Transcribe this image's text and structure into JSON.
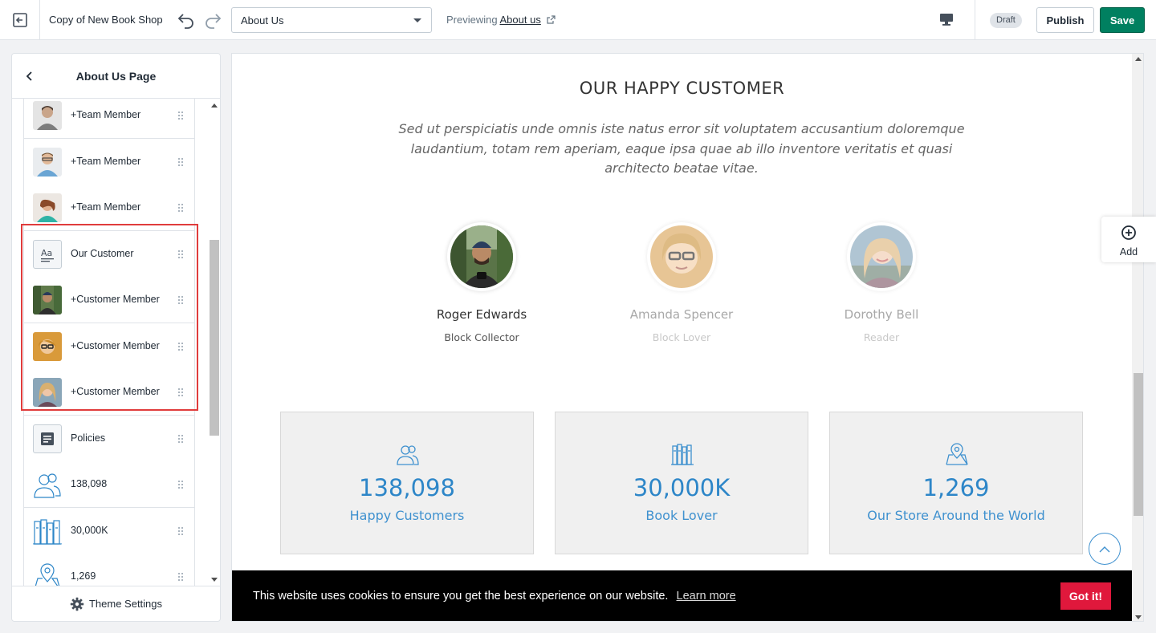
{
  "topbar": {
    "shop_name": "Copy of New Book Shop",
    "page_select_value": "About Us",
    "previewing_label": "Previewing",
    "previewing_link": "About us",
    "draft_badge": "Draft",
    "publish_label": "Publish",
    "save_label": "Save"
  },
  "sidebar": {
    "title": "About Us Page",
    "items": [
      {
        "label": "+Team Member",
        "icon": "team-member-thumb"
      },
      {
        "label": "+Team Member",
        "icon": "team-member-thumb"
      },
      {
        "label": "+Team Member",
        "icon": "team-member-thumb"
      },
      {
        "label": "Our Customer",
        "icon": "text-block-icon"
      },
      {
        "label": "+Customer Member",
        "icon": "customer-member-thumb"
      },
      {
        "label": "+Customer Member",
        "icon": "customer-member-thumb"
      },
      {
        "label": "+Customer Member",
        "icon": "customer-member-thumb"
      },
      {
        "label": "Policies",
        "icon": "document-icon"
      },
      {
        "label": "138,098",
        "icon": "users-icon"
      },
      {
        "label": "30,000K",
        "icon": "books-icon"
      },
      {
        "label": "1,269",
        "icon": "map-pin-icon"
      }
    ],
    "footer_label": "Theme Settings"
  },
  "preview": {
    "section_title": "OUR HAPPY CUSTOMER",
    "quote": "Sed ut perspiciatis unde omnis iste natus error sit voluptatem accusantium doloremque laudantium, totam rem aperiam, eaque ipsa quae ab illo inventore veritatis et quasi architecto beatae vitae.",
    "customers": [
      {
        "name": "Roger Edwards",
        "role": "Block Collector"
      },
      {
        "name": "Amanda Spencer",
        "role": "Block Lover"
      },
      {
        "name": "Dorothy Bell",
        "role": "Reader"
      }
    ],
    "stats": [
      {
        "value": "138,098",
        "caption": "Happy Customers",
        "icon": "users-icon"
      },
      {
        "value": "30,000K",
        "caption": "Book Lover",
        "icon": "books-icon"
      },
      {
        "value": "1,269",
        "caption": "Our Store Around the World",
        "icon": "map-pin-icon"
      }
    ],
    "cookie": {
      "text": "This website uses cookies to ensure you get the best experience on our website.",
      "link": "Learn more",
      "button": "Got it!"
    }
  },
  "add_button_label": "Add",
  "colors": {
    "save_green": "#008060",
    "highlight_red": "#e03c3c",
    "stat_blue": "#2d86c8",
    "cookie_button": "#e0183c"
  }
}
